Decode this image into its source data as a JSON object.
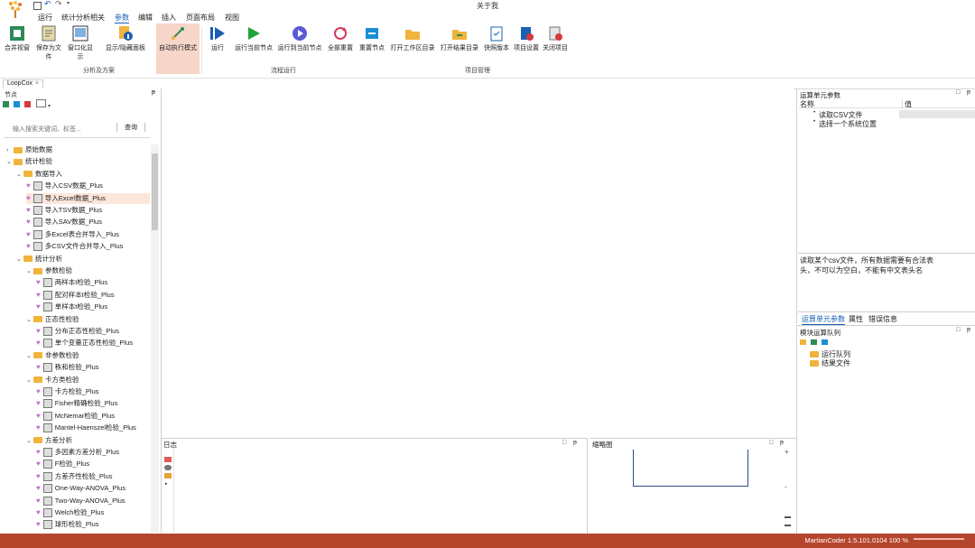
{
  "window": {
    "title": "关于我"
  },
  "menu": [
    "运行",
    "统计分析相关",
    "参数",
    "编辑",
    "插入",
    "页面布局",
    "视图"
  ],
  "menu_active_index": 2,
  "ribbon": {
    "buttons": [
      {
        "label": "合并视窗"
      },
      {
        "label": "保存为文件"
      },
      {
        "label": "窗口化显示"
      },
      {
        "label": "显示/隐藏面板"
      },
      {
        "label": "自动执行模式"
      },
      {
        "label": "运行"
      },
      {
        "label": "运行当前节点"
      },
      {
        "label": "运行到当前节点"
      },
      {
        "label": "全部重置"
      },
      {
        "label": "重置节点"
      },
      {
        "label": "打开工作区目录"
      },
      {
        "label": "打开结果目录"
      },
      {
        "label": "快照版本"
      },
      {
        "label": "项目设置"
      },
      {
        "label": "关闭项目"
      }
    ],
    "groups": [
      {
        "label": "分析及方案"
      },
      {
        "label": "流程运行"
      },
      {
        "label": "项目管理"
      }
    ]
  },
  "tab": {
    "label": "LoopCox"
  },
  "left_panel": {
    "title": "节点",
    "search_placeholder": "输入搜索关键词、标签...",
    "search_button": "查询",
    "tree": [
      {
        "label": "原始数据",
        "level": 0,
        "kind": "folder",
        "expanded": false
      },
      {
        "label": "统计检验",
        "level": 0,
        "kind": "folder",
        "expanded": true
      },
      {
        "label": "数据导入",
        "level": 1,
        "kind": "folder",
        "expanded": true
      },
      {
        "label": "导入CSV数据_Plus",
        "level": 2,
        "kind": "item"
      },
      {
        "label": "导入Excel数据_Plus",
        "level": 2,
        "kind": "item",
        "highlight": true
      },
      {
        "label": "导入TSV数据_Plus",
        "level": 2,
        "kind": "item"
      },
      {
        "label": "导入SAV数据_Plus",
        "level": 2,
        "kind": "item"
      },
      {
        "label": "多Excel表合并导入_Plus",
        "level": 2,
        "kind": "item"
      },
      {
        "label": "多CSV文件合并导入_Plus",
        "level": 2,
        "kind": "item"
      },
      {
        "label": "统计分析",
        "level": 1,
        "kind": "folder",
        "expanded": true
      },
      {
        "label": "参数检验",
        "level": 2,
        "kind": "folder",
        "expanded": true
      },
      {
        "label": "两样本t检验_Plus",
        "level": 3,
        "kind": "item"
      },
      {
        "label": "配对样本t检验_Plus",
        "level": 3,
        "kind": "item"
      },
      {
        "label": "单样本t检验_Plus",
        "level": 3,
        "kind": "item"
      },
      {
        "label": "正态性检验",
        "level": 2,
        "kind": "folder",
        "expanded": true
      },
      {
        "label": "分布正态性检验_Plus",
        "level": 3,
        "kind": "item"
      },
      {
        "label": "单个变量正态性检验_Plus",
        "level": 3,
        "kind": "item"
      },
      {
        "label": "非参数检验",
        "level": 2,
        "kind": "folder",
        "expanded": true
      },
      {
        "label": "秩和检验_Plus",
        "level": 3,
        "kind": "item"
      },
      {
        "label": "卡方类检验",
        "level": 2,
        "kind": "folder",
        "expanded": true
      },
      {
        "label": "卡方检验_Plus",
        "level": 3,
        "kind": "item"
      },
      {
        "label": "Fisher精确检验_Plus",
        "level": 3,
        "kind": "item"
      },
      {
        "label": "McNemar检验_Plus",
        "level": 3,
        "kind": "item"
      },
      {
        "label": "Mantel-Haenszel检验_Plus",
        "level": 3,
        "kind": "item"
      },
      {
        "label": "方差分析",
        "level": 2,
        "kind": "folder",
        "expanded": true
      },
      {
        "label": "多因素方差分析_Plus",
        "level": 3,
        "kind": "item"
      },
      {
        "label": "F检验_Plus",
        "level": 3,
        "kind": "item"
      },
      {
        "label": "方差齐性检验_Plus",
        "level": 3,
        "kind": "item"
      },
      {
        "label": "One-Way-ANOVA_Plus",
        "level": 3,
        "kind": "item"
      },
      {
        "label": "Two-Way-ANOVA_Plus",
        "level": 3,
        "kind": "item"
      },
      {
        "label": "Welch检验_Plus",
        "level": 3,
        "kind": "item"
      },
      {
        "label": "球形检验_Plus",
        "level": 3,
        "kind": "item"
      }
    ]
  },
  "params_panel": {
    "title": "运算单元参数",
    "col_name": "名称",
    "col_value": "值",
    "rows": [
      "读取CSV文件",
      "选择一个系统位置"
    ],
    "description": "读取某个csv文件，所有数据需要有合法表头，不可以为空白，不能有中文表头名",
    "tabs": [
      "运算单元参数",
      "属性",
      "错误信息"
    ]
  },
  "run_queue_panel": {
    "title": "模块运算队列",
    "items": [
      "运行队列",
      "结果文件"
    ]
  },
  "log_panel": {
    "title": "日志"
  },
  "preview_panel": {
    "title": "缩略图"
  },
  "status": {
    "text": "MartianCoder 1.5.101.0104 100 %"
  },
  "colors": {
    "status_bar": "#b5452d",
    "accent": "#1a5fb4",
    "highlight": "#fde6da"
  }
}
